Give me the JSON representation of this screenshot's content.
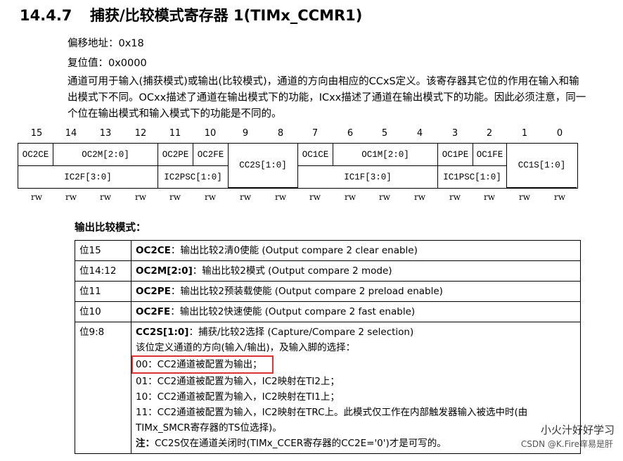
{
  "header": {
    "section": "14.4.7",
    "title": "捕获/比较模式寄存器 1(TIMx_CCMR1)"
  },
  "offset": "偏移地址：0x18",
  "reset": "复位值：0x0000",
  "description": "通道可用于输入(捕获模式)或输出(比较模式)，通道的方向由相应的CCxS定义。该寄存器其它位的作用在输入和输出模式下不同。OCxx描述了通道在输出模式下的功能，ICxx描述了通道在输出模式下的功能。因此必须注意，同一个位在输出模式和输入模式下的功能是不同的。",
  "bit_numbers": [
    "15",
    "14",
    "13",
    "12",
    "11",
    "10",
    "9",
    "8",
    "7",
    "6",
    "5",
    "4",
    "3",
    "2",
    "1",
    "0"
  ],
  "register": {
    "top_row": [
      "OC2CE",
      "OC2M[2:0]",
      "OC2PE",
      "OC2FE",
      "CC2S[1:0]",
      "OC1CE",
      "OC1M[2:0]",
      "OC1PE",
      "OC1FE",
      "CC1S[1:0]"
    ],
    "bottom_row": [
      "IC2F[3:0]",
      "IC2PSC[1:0]",
      "IC1F[3:0]",
      "IC1PSC[1:0]"
    ]
  },
  "access": [
    "rw",
    "rw",
    "rw",
    "rw",
    "rw",
    "rw",
    "rw",
    "rw",
    "rw",
    "rw",
    "rw",
    "rw",
    "rw",
    "rw",
    "rw",
    "rw"
  ],
  "output_mode_title": "输出比较模式：",
  "fields": [
    {
      "bits": "位15",
      "name": "OC2CE",
      "desc": "：输出比较2清0使能 (Output compare 2 clear enable)"
    },
    {
      "bits": "位14:12",
      "name": "OC2M[2:0]",
      "desc": "：输出比较2模式 (Output compare 2 mode)"
    },
    {
      "bits": "位11",
      "name": "OC2PE",
      "desc": "：输出比较2预装载使能 (Output compare 2 preload enable)"
    },
    {
      "bits": "位10",
      "name": "OC2FE",
      "desc": "：输出比较2快速使能 (Output compare 2 fast enable)"
    },
    {
      "bits": "位9:8",
      "name": "CC2S[1:0]",
      "desc": "：捕获/比较2选择 (Capture/Compare 2 selection)",
      "line1": "该位定义通道的方向(输入/输出)，及输入脚的选择：",
      "opt00": "00：CC2通道被配置为输出；",
      "opt01": "01：CC2通道被配置为输入，IC2映射在TI2上；",
      "opt10": "10：CC2通道被配置为输入，IC2映射在TI1上；",
      "opt11": "11：CC2通道被配置为输入，IC2映射在TRC上。此模式仅工作在内部触发器输入被选中时(由TIMx_SMCR寄存器的TS位选择)。",
      "note_label": "注：",
      "note": "CC2S仅在通道关闭时(TIMx_CCER寄存器的CC2E='0')才是可写的。"
    }
  ],
  "watermark": "小火汁好好学习",
  "watermark2": "CSDN @K.Fire痒易是肝"
}
